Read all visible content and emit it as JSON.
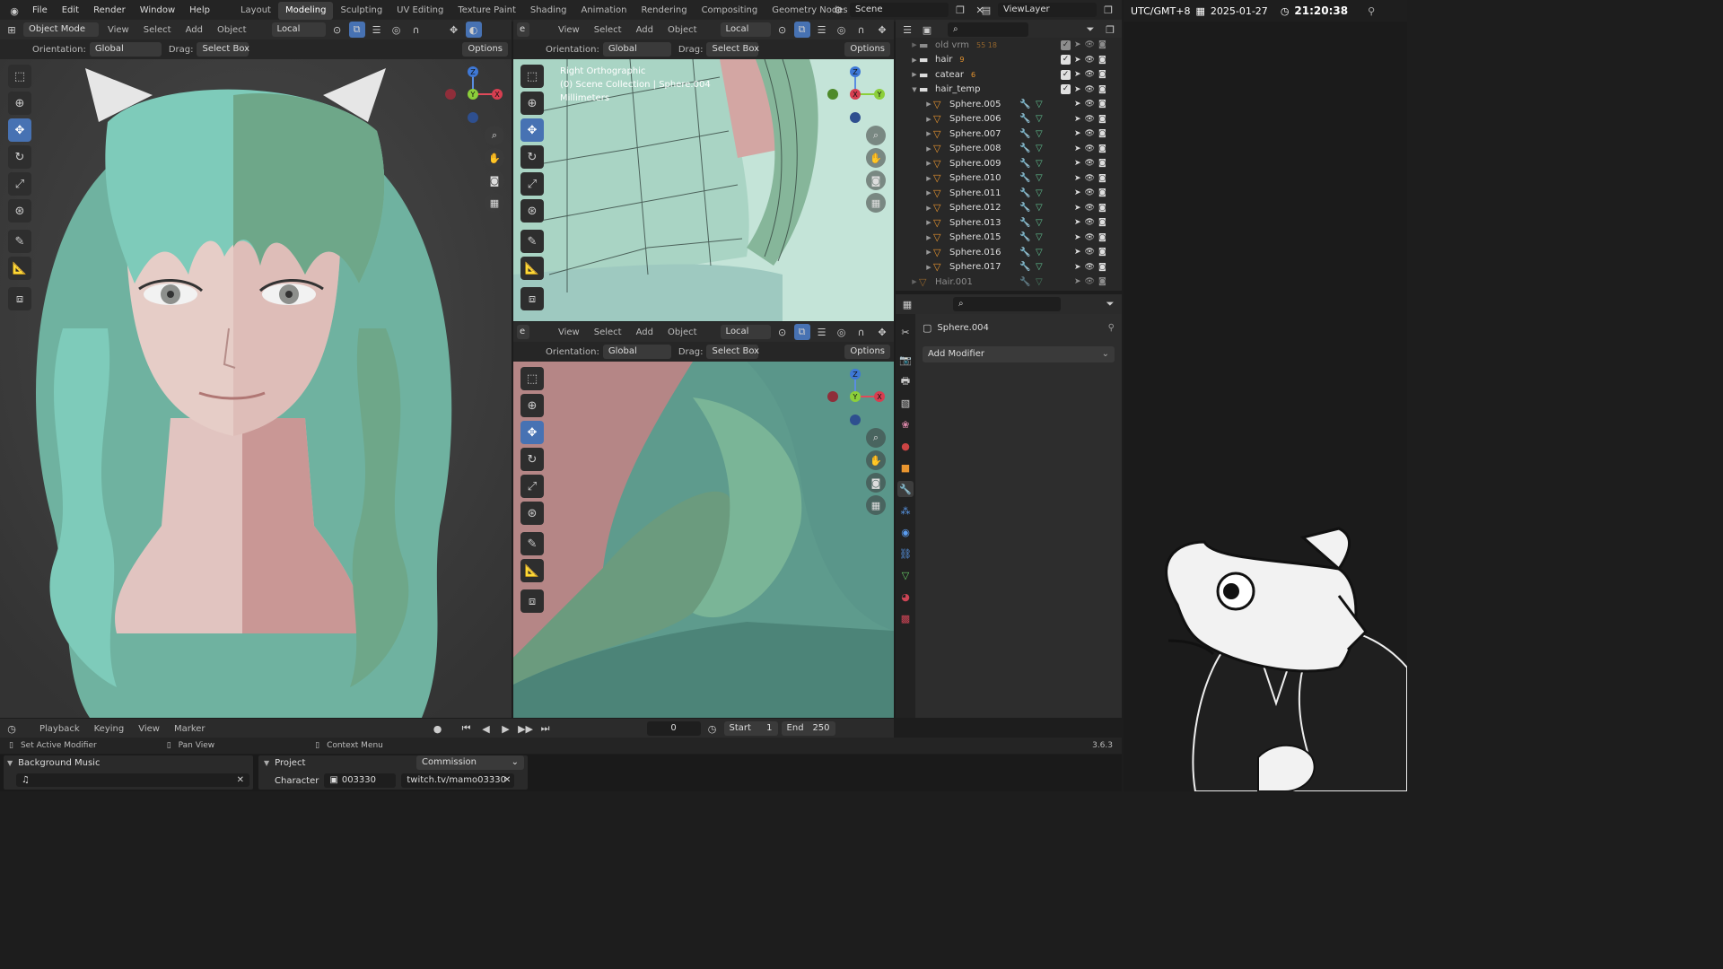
{
  "menus": [
    "File",
    "Edit",
    "Render",
    "Window",
    "Help"
  ],
  "workspaces": [
    "Layout",
    "Modeling",
    "Sculpting",
    "UV Editing",
    "Texture Paint",
    "Shading",
    "Animation",
    "Rendering",
    "Compositing",
    "Geometry Nodes",
    "Scripting"
  ],
  "active_workspace": "Modeling",
  "add_workspace": "+",
  "scene_label": "Scene",
  "viewlayer_label": "ViewLayer",
  "clock": {
    "timezone": "UTC/GMT+8",
    "date": "2025-01-27",
    "time": "21:20:38"
  },
  "viewport_main": {
    "mode": "Object Mode",
    "menus": [
      "View",
      "Select",
      "Add",
      "Object"
    ],
    "transform_space": "Local",
    "orientation_label": "Orientation:",
    "orientation_value": "Global",
    "drag_label": "Drag:",
    "drag_value": "Select Box",
    "options": "Options"
  },
  "viewport_top_right": {
    "mode_cut": "e",
    "menus": [
      "View",
      "Select",
      "Add",
      "Object"
    ],
    "transform_space": "Local",
    "orientation_label": "Orientation:",
    "orientation_value": "Global",
    "drag_label": "Drag:",
    "drag_value": "Select Box",
    "options": "Options",
    "overlay_text": [
      "Right Orthographic",
      "(0) Scene Collection | Sphere.004",
      "Millimeters"
    ]
  },
  "viewport_bottom_right": {
    "mode_cut": "e",
    "menus": [
      "View",
      "Select",
      "Add",
      "Object"
    ],
    "transform_space": "Local",
    "orientation_label": "Orientation:",
    "orientation_value": "Global",
    "drag_label": "Drag:",
    "drag_value": "Select Box",
    "options": "Options"
  },
  "gizmo_labels": {
    "z": "Z",
    "y": "Y",
    "x": "X"
  },
  "outliner": {
    "rows": [
      {
        "name": "old vrm",
        "indent": 0,
        "type": "collection",
        "extra": "55 18",
        "dim": true
      },
      {
        "name": "hair",
        "indent": 0,
        "type": "collection",
        "extra": "9"
      },
      {
        "name": "catear",
        "indent": 0,
        "type": "collection",
        "extra": "6"
      },
      {
        "name": "hair_temp",
        "indent": 0,
        "type": "collection",
        "expanded": true
      },
      {
        "name": "Sphere.005",
        "indent": 1,
        "type": "mesh"
      },
      {
        "name": "Sphere.006",
        "indent": 1,
        "type": "mesh"
      },
      {
        "name": "Sphere.007",
        "indent": 1,
        "type": "mesh"
      },
      {
        "name": "Sphere.008",
        "indent": 1,
        "type": "mesh"
      },
      {
        "name": "Sphere.009",
        "indent": 1,
        "type": "mesh"
      },
      {
        "name": "Sphere.010",
        "indent": 1,
        "type": "mesh"
      },
      {
        "name": "Sphere.011",
        "indent": 1,
        "type": "mesh"
      },
      {
        "name": "Sphere.012",
        "indent": 1,
        "type": "mesh"
      },
      {
        "name": "Sphere.013",
        "indent": 1,
        "type": "mesh"
      },
      {
        "name": "Sphere.015",
        "indent": 1,
        "type": "mesh"
      },
      {
        "name": "Sphere.016",
        "indent": 1,
        "type": "mesh"
      },
      {
        "name": "Sphere.017",
        "indent": 1,
        "type": "mesh"
      },
      {
        "name": "Hair.001",
        "indent": 0,
        "type": "mesh",
        "dim": true
      }
    ]
  },
  "properties": {
    "object_name": "Sphere.004",
    "add_modifier": "Add Modifier"
  },
  "timeline": {
    "menus": [
      "Playback",
      "Keying",
      "View",
      "Marker"
    ],
    "current_frame": "0",
    "start_label": "Start",
    "start_value": "1",
    "end_label": "End",
    "end_value": "250"
  },
  "statusbar": {
    "left": "Set Active Modifier",
    "middle": "Pan View",
    "right": "Context Menu",
    "version": "3.6.3"
  },
  "bottom_panels": {
    "bgm_title": "Background Music",
    "project_title": "Project",
    "project_value": "Commission",
    "character_label": "Character",
    "character_code": "003330",
    "character_url": "twitch.tv/mamo03330"
  },
  "colors": {
    "accent": "#4772b3",
    "hair": "#7cc7b6",
    "hair_dark": "#6aa888",
    "skin": "#e6c7c3",
    "shadow_skin": "#cd9a9a",
    "orange": "#e8952f"
  }
}
